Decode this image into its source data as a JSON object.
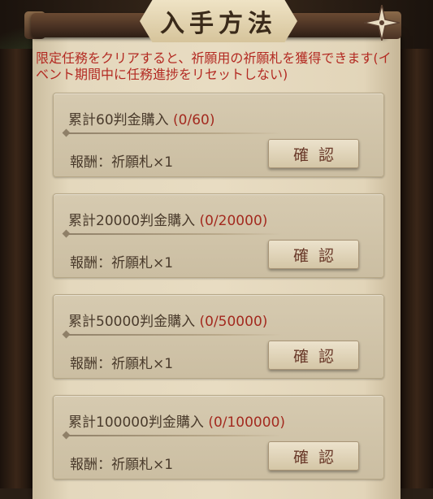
{
  "header": {
    "title": "入手方法"
  },
  "description": "限定任務をクリアすると、祈願用の祈願札を獲得できます(イベント期間中に任務進捗をリセットしない)",
  "tasks": [
    {
      "label": "累計60判金購入",
      "progress": "(0/60)",
      "reward": "報酬：祈願札×1",
      "button": "確認"
    },
    {
      "label": "累計20000判金購入",
      "progress": "(0/20000)",
      "reward": "報酬：祈願札×1",
      "button": "確認"
    },
    {
      "label": "累計50000判金購入",
      "progress": "(0/50000)",
      "reward": "報酬：祈願札×1",
      "button": "確認"
    },
    {
      "label": "累計100000判金購入",
      "progress": "(0/100000)",
      "reward": "報酬：祈願札×1",
      "button": "確認"
    }
  ],
  "colors": {
    "accent_red": "#b32a22",
    "paper": "#e8dcc2",
    "card": "#d6cab0"
  }
}
